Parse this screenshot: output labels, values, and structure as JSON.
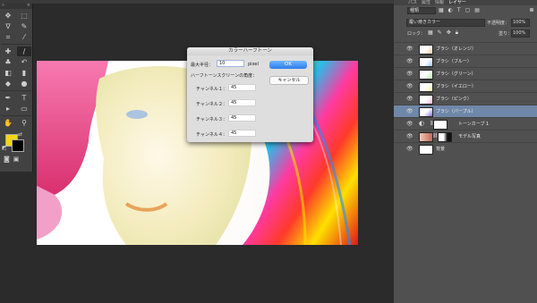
{
  "colors": {
    "foreground": "#f5d60f",
    "background": "#000000",
    "dialog_ok": "#2d7ee8",
    "selected_layer": "#6f87a8"
  },
  "top_tabs": [
    "パス",
    "属性",
    "情報",
    "レイヤー"
  ],
  "tools": {
    "collapse_icon": "double-chevron-icon",
    "close_icon": "close-icon",
    "items": [
      {
        "name": "move-tool-icon",
        "glyph": "✥"
      },
      {
        "name": "selection-tool-icon",
        "glyph": "⬚"
      },
      {
        "name": "lasso-tool-icon",
        "glyph": "ᐁ"
      },
      {
        "name": "quick-select-tool-icon",
        "glyph": "✎"
      },
      {
        "name": "crop-tool-icon",
        "glyph": "⌗"
      },
      {
        "name": "eyedropper-tool-icon",
        "glyph": "⁄"
      },
      {
        "name": "healing-brush-tool-icon",
        "glyph": "✚"
      },
      {
        "name": "brush-tool-icon",
        "glyph": "∕"
      },
      {
        "name": "clone-stamp-tool-icon",
        "glyph": "♣"
      },
      {
        "name": "history-brush-tool-icon",
        "glyph": "↶"
      },
      {
        "name": "eraser-tool-icon",
        "glyph": "◧"
      },
      {
        "name": "gradient-tool-icon",
        "glyph": "▮"
      },
      {
        "name": "blur-tool-icon",
        "glyph": "◆"
      },
      {
        "name": "dodge-tool-icon",
        "glyph": "●"
      },
      {
        "name": "pen-tool-icon",
        "glyph": "✒"
      },
      {
        "name": "type-tool-icon",
        "glyph": "T"
      },
      {
        "name": "path-select-tool-icon",
        "glyph": "▸"
      },
      {
        "name": "shape-tool-icon",
        "glyph": "▭"
      },
      {
        "name": "hand-tool-icon",
        "glyph": "✋"
      },
      {
        "name": "zoom-tool-icon",
        "glyph": "⚲"
      }
    ],
    "active_tool": "brush-tool-icon"
  },
  "layers_panel": {
    "kind_filter": "種類",
    "blend_mode": "覆い焼きカラー",
    "opacity_label": "不透明度：",
    "opacity_value": "100%",
    "lock_label": "ロック：",
    "fill_label": "塗り：",
    "fill_value": "100%",
    "layers": [
      {
        "name": "ブラシ（オレンジ）",
        "selected": false,
        "type": "pixel"
      },
      {
        "name": "ブラシ（ブルー）",
        "selected": false,
        "type": "pixel"
      },
      {
        "name": "ブラシ（グリーン）",
        "selected": false,
        "type": "pixel"
      },
      {
        "name": "ブラシ（イエロー）",
        "selected": false,
        "type": "pixel"
      },
      {
        "name": "ブラシ（ピンク）",
        "selected": false,
        "type": "pixel"
      },
      {
        "name": "ブラシ（パープル）",
        "selected": true,
        "type": "pixel"
      },
      {
        "name": "トーンカーブ 1",
        "selected": false,
        "type": "adjustment"
      },
      {
        "name": "モデル写真",
        "selected": false,
        "type": "masked"
      },
      {
        "name": "背景",
        "selected": false,
        "type": "pixel"
      }
    ]
  },
  "dialog": {
    "title": "カラーハーフトーン",
    "max_radius_label": "最大半径：",
    "max_radius_value": "10",
    "max_radius_unit": "pixel",
    "angle_heading": "ハーフトーンスクリーンの角度：",
    "channels": [
      {
        "label": "チャンネル１：",
        "value": "45"
      },
      {
        "label": "チャンネル２：",
        "value": "45"
      },
      {
        "label": "チャンネル３：",
        "value": "45"
      },
      {
        "label": "チャンネル４：",
        "value": "45"
      }
    ],
    "ok_label": "OK",
    "cancel_label": "キャンセル"
  }
}
